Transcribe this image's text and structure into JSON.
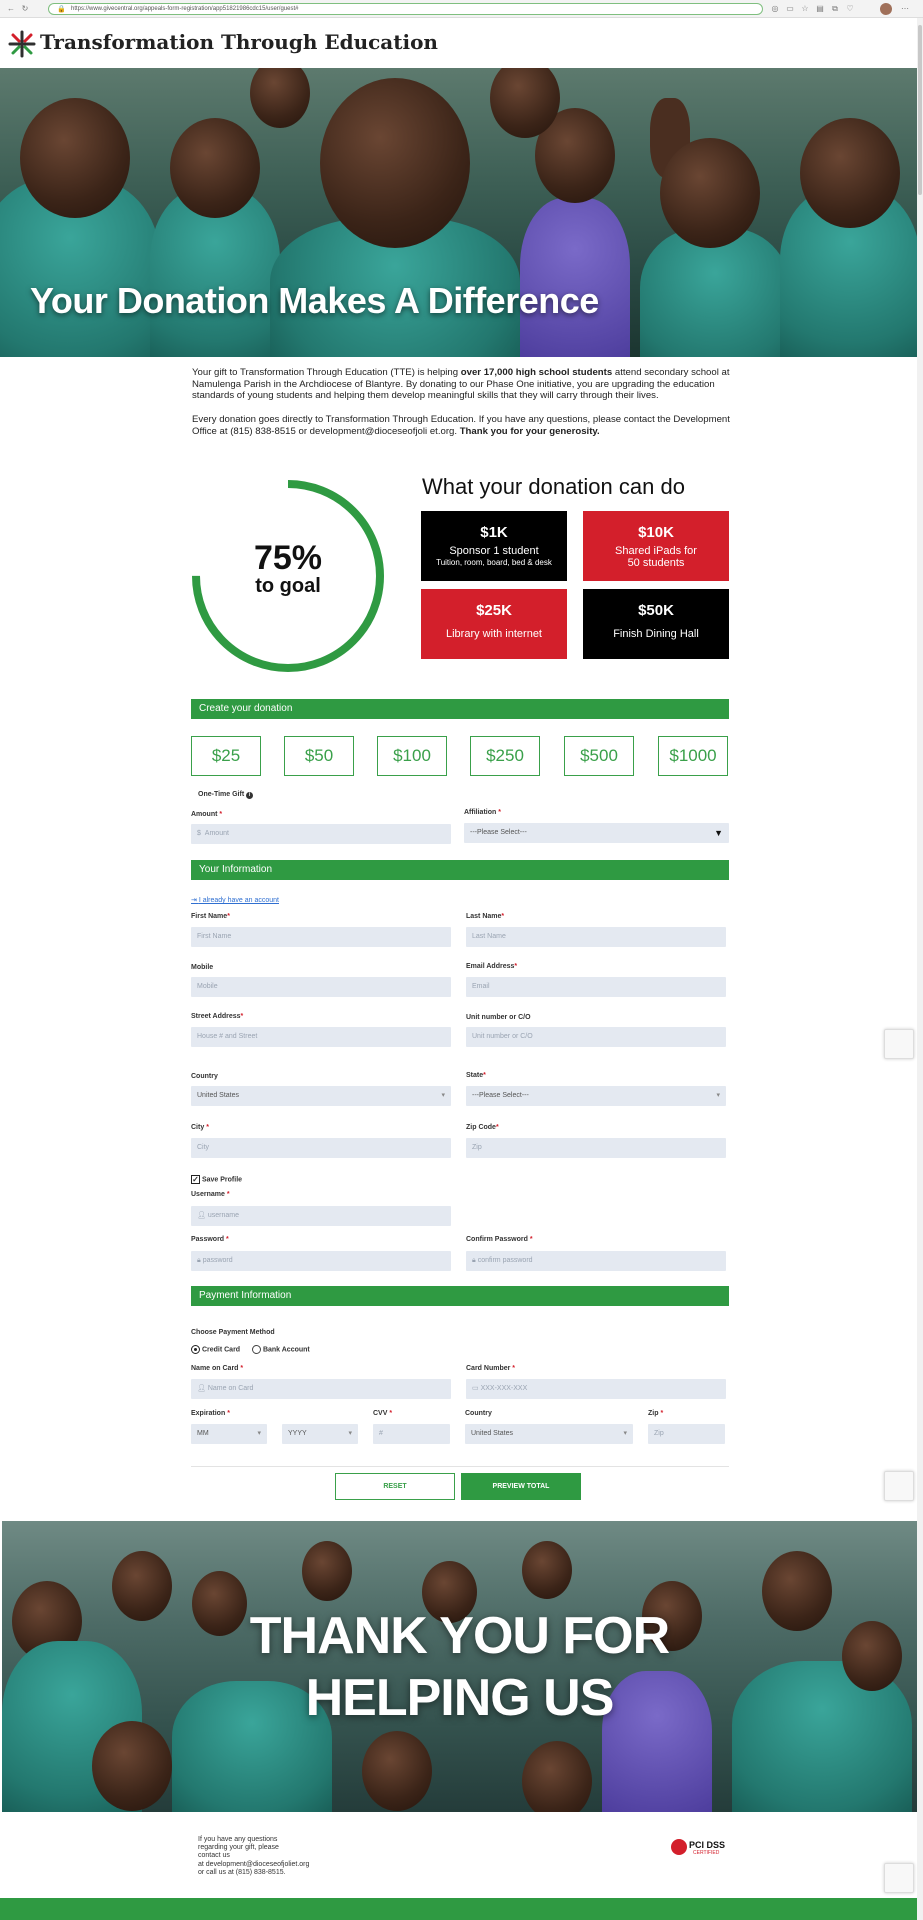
{
  "browser": {
    "url": "https://www.givecentral.org/appeals-form-registration/app51821986cdc15/user/guest#"
  },
  "header": {
    "site_title": "Transformation Through Education"
  },
  "hero": {
    "title": "Your Donation Makes A Difference"
  },
  "intro": {
    "p1_a": "Your gift to Transformation Through Education (TTE) is helping ",
    "p1_bold": "over 17,000 high school students",
    "p1_b": " attend secondary school at Namulenga Parish in the Archdiocese of Blantyre. By donating to our Phase One initiative, you are upgrading the education standards of young students and helping them develop meaningful skills that they will carry through their lives.",
    "p2_a": "Every donation goes directly to Transformation Through Education. If you have any questions, please contact the Development Office at (815) 838-8515 or development@dioceseofjoli et.org. ",
    "p2_bold": "Thank you for your generosity."
  },
  "progress": {
    "percent_label": "75%",
    "goal_label": "to goal",
    "fraction": 0.75,
    "color": "#2f9a42"
  },
  "impact": {
    "title": "What your donation can do",
    "tiles": [
      {
        "amount": "$1K",
        "line1": "Sponsor 1 student",
        "line2": "Tuition, room, board, bed & desk"
      },
      {
        "amount": "$10K",
        "line1": "Shared iPads for 50 students",
        "line2": ""
      },
      {
        "amount": "$25K",
        "line1": "Library with internet",
        "line2": ""
      },
      {
        "amount": "$50K",
        "line1": "Finish Dining Hall",
        "line2": ""
      }
    ]
  },
  "donation": {
    "section_title": "Create your donation",
    "amounts": [
      "$25",
      "$50",
      "$100",
      "$250",
      "$500",
      "$1000"
    ],
    "one_time_label": "One-Time Gift",
    "amount_label": "Amount",
    "amount_placeholder": "Amount",
    "currency_symbol": "$",
    "affiliation_label": "Affiliation",
    "affiliation_value": "---Please Select---"
  },
  "info": {
    "section_title": "Your Information",
    "login_link": "I already have an account",
    "first_name_label": "First Name",
    "first_name_placeholder": "First Name",
    "last_name_label": "Last Name",
    "last_name_placeholder": "Last Name",
    "mobile_label": "Mobile",
    "mobile_placeholder": "Mobile",
    "email_label": "Email Address",
    "email_placeholder": "Email",
    "street_label": "Street Address",
    "street_placeholder": "House # and Street",
    "unit_label": "Unit number or C/O",
    "unit_placeholder": "Unit number or C/O",
    "country_label": "Country",
    "country_value": "United States",
    "state_label": "State",
    "state_value": "---Please Select---",
    "city_label": "City",
    "city_placeholder": "City",
    "zip_label": "Zip Code",
    "zip_placeholder": "Zip",
    "save_profile_label": "Save Profile",
    "username_label": "Username",
    "username_placeholder": "username",
    "password_label": "Password",
    "password_placeholder": "password",
    "confirm_label": "Confirm Password",
    "confirm_placeholder": "confirm password"
  },
  "payment": {
    "section_title": "Payment Information",
    "method_label": "Choose Payment Method",
    "credit_label": "Credit Card",
    "bank_label": "Bank Account",
    "name_label": "Name on Card",
    "name_placeholder": "Name on Card",
    "card_label": "Card Number",
    "card_placeholder": "XXX-XXX-XXX",
    "expiration_label": "Expiration",
    "month_value": "MM",
    "year_value": "YYYY",
    "cvv_label": "CVV",
    "cvv_placeholder": "#",
    "country_label": "Country",
    "country_value": "United States",
    "zip_label": "Zip",
    "zip_placeholder": "Zip"
  },
  "actions": {
    "reset_label": "RESET",
    "preview_label": "PREVIEW TOTAL"
  },
  "thanks": {
    "line1": "THANK YOU FOR",
    "line2": "HELPING US"
  },
  "footer": {
    "lines": [
      "If you have any questions",
      "regarding your gift, please",
      "contact us",
      "at development@dioceseofjoliet.org",
      "or call us at (815) 838-8515."
    ],
    "pci_text": "PCI DSS",
    "pci_sub": "CERTIFIED"
  },
  "colors": {
    "accent_green": "#2f9a42",
    "tile_red": "#d31f2b",
    "tile_black": "#000000"
  }
}
